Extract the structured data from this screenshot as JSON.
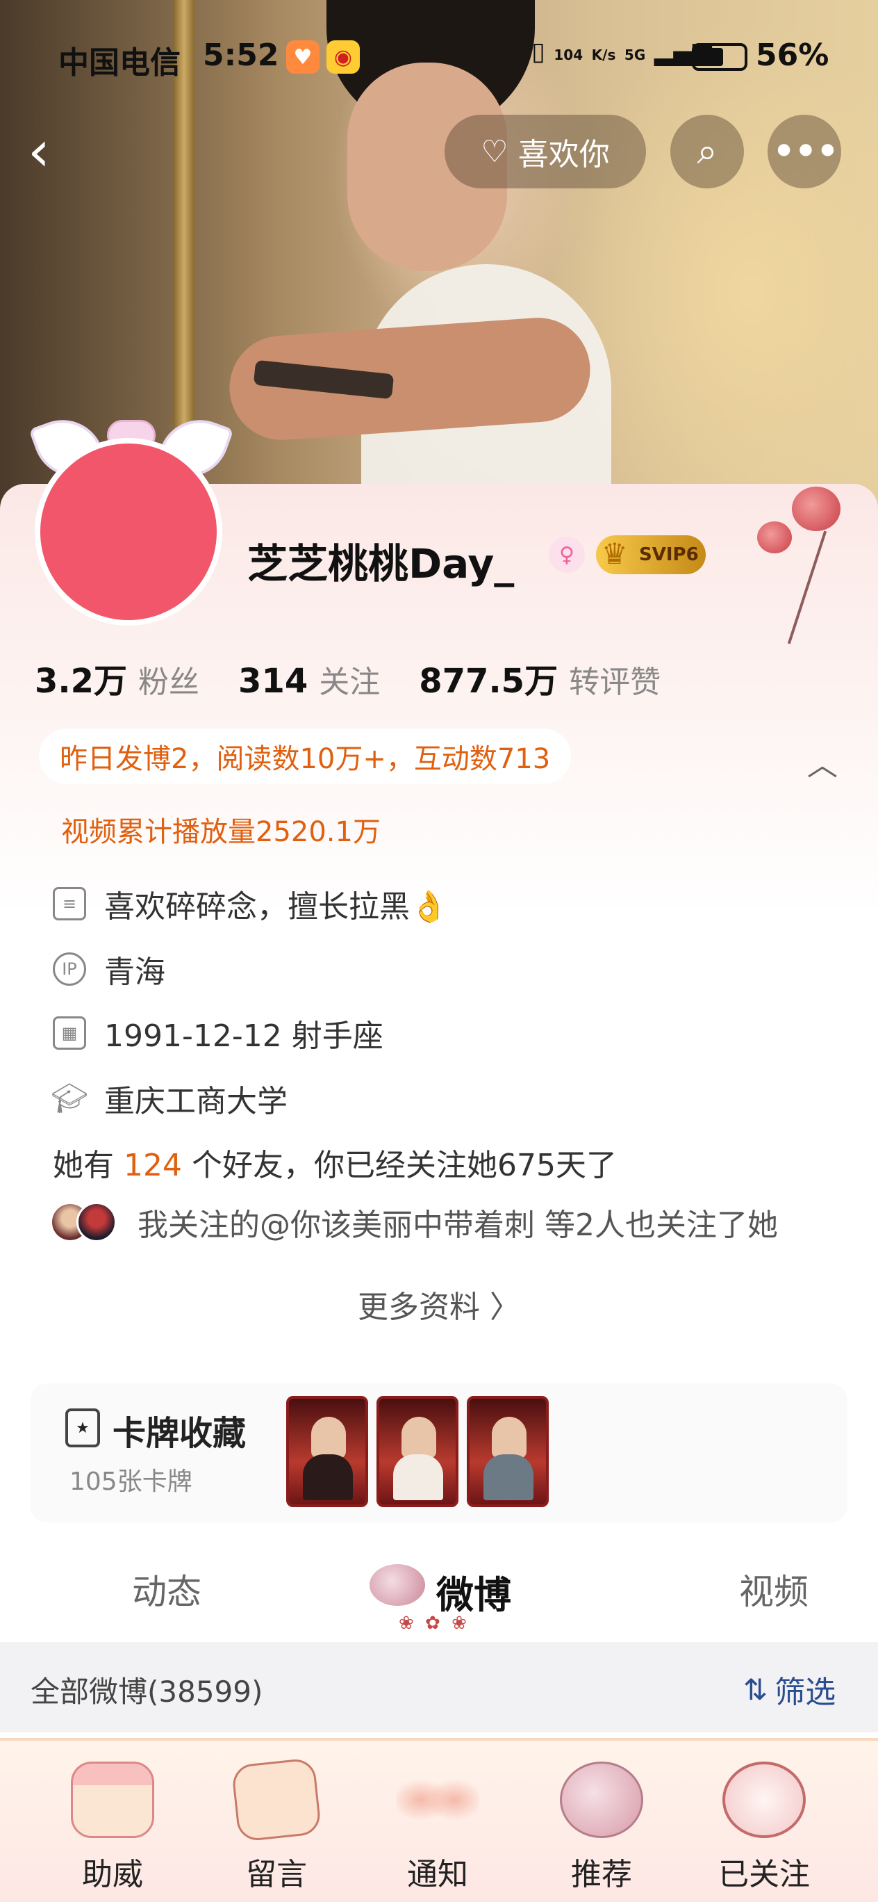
{
  "status_bar": {
    "carrier": "中国电信",
    "time": "5:52",
    "net_speed_value": "104",
    "net_speed_unit": "K/s",
    "network": "5G",
    "battery": "56%"
  },
  "header": {
    "like_button_label": "喜欢你",
    "icons": [
      "back-arrow-icon",
      "heart-hand-icon",
      "search-icon",
      "more-icon"
    ]
  },
  "profile": {
    "username": "芝芝桃桃Day_",
    "svip_badge": "SVIP6",
    "stats": [
      {
        "value": "3.2万",
        "label": "粉丝"
      },
      {
        "value": "314",
        "label": "关注"
      },
      {
        "value": "877.5万",
        "label": "转评赞"
      }
    ],
    "highlight": "昨日发博2，阅读数10万+，互动数713",
    "video_stat": "视频累计播放量2520.1万",
    "bio": "喜欢碎碎念，擅长拉黑👌",
    "ip_location": "青海",
    "birthday": "1991-12-12 射手座",
    "school": "重庆工商大学",
    "friends_prefix": "她有",
    "friends_count": "124",
    "friends_suffix": "个好友，你已经关注她675天了",
    "mutual_follow": "我关注的@你该美丽中带着刺 等2人也关注了她",
    "more_info": "更多资料 〉"
  },
  "card_collection": {
    "title": "卡牌收藏",
    "count": "105张卡牌"
  },
  "tabs": {
    "dynamic": "动态",
    "weibo": "微博",
    "video": "视频",
    "active": "微博"
  },
  "filter_bar": {
    "all_posts": "全部微博(38599)",
    "filter": "筛选"
  },
  "bottom_nav": [
    {
      "label": "助威",
      "icon": "cake-icon"
    },
    {
      "label": "留言",
      "icon": "letter-icon"
    },
    {
      "label": "通知",
      "icon": "butterfly-icon"
    },
    {
      "label": "推荐",
      "icon": "globe-icon"
    },
    {
      "label": "已关注",
      "icon": "clock-icon"
    }
  ],
  "colors": {
    "accent_orange": "#e06010",
    "filter_blue": "#2a4d8f",
    "avatar_red": "#f2566a"
  }
}
